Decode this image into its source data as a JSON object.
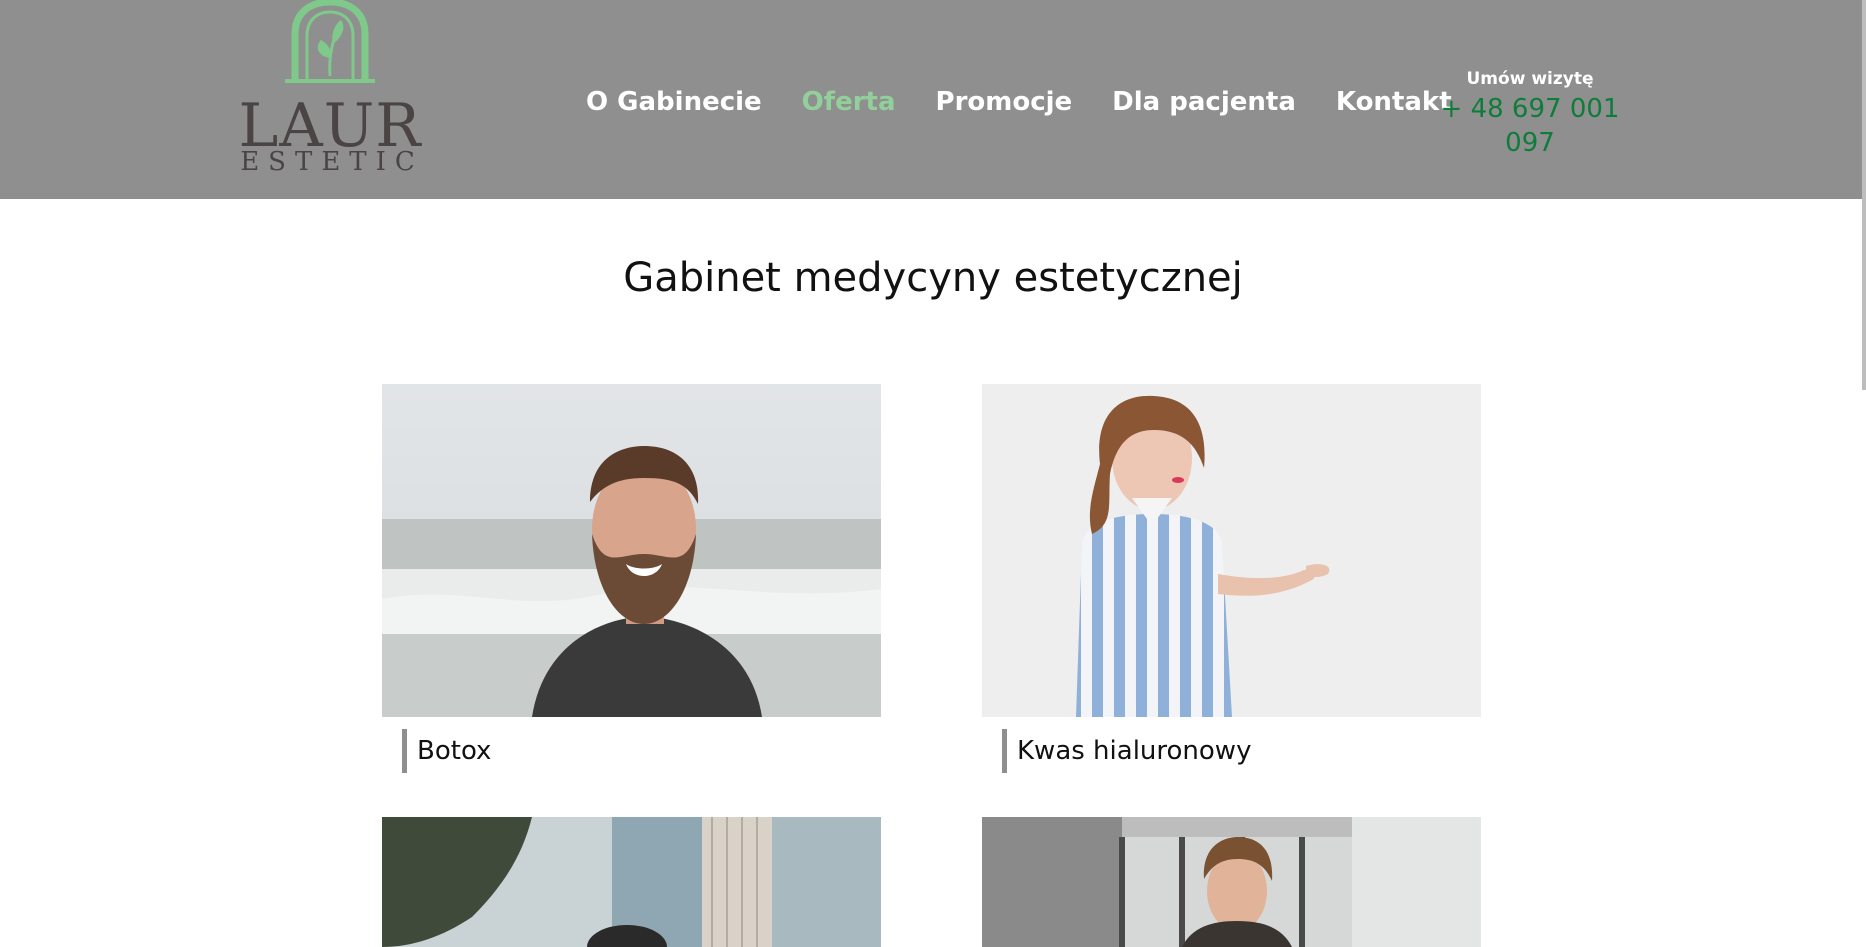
{
  "brand": {
    "logo_word": "LAUR",
    "logo_sub": "ESTETIC",
    "accent_color": "#93cf9a",
    "header_bg": "#8f8f8f"
  },
  "nav": {
    "items": [
      {
        "label": "O Gabinecie",
        "active": false
      },
      {
        "label": "Oferta",
        "active": true
      },
      {
        "label": "Promocje",
        "active": false
      },
      {
        "label": "Dla pacjenta",
        "active": false
      },
      {
        "label": "Kontakt",
        "active": false
      }
    ]
  },
  "contact": {
    "label": "Umów wizytę",
    "phone": "+ 48 697 001 097",
    "phone_color": "#0f7d3a"
  },
  "main": {
    "title": "Gabinet medycyny estetycznej",
    "cards": [
      {
        "title": "Botox",
        "image": "bearded-man-photo"
      },
      {
        "title": "Kwas hialuronowy",
        "image": "woman-striped-dress-photo"
      },
      {
        "title": "",
        "image": "woman-city-photo"
      },
      {
        "title": "",
        "image": "smiling-man-office-photo"
      }
    ]
  }
}
